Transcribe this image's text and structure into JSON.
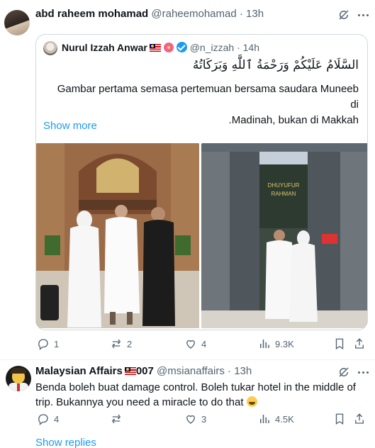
{
  "tweet1": {
    "author_name": "abd raheem mohamad",
    "author_handle": "@raheemohamad",
    "time": "13h",
    "quoted": {
      "author_name": "Nurul Izzah Anwar",
      "author_handle": "@n_izzah",
      "time": "14h",
      "arabic_greeting": "السَّلَامُ عَلَيْكُمْ وَرَحْمَةُ ٱللَّٰهِ وَبَرَكَاتُهُ",
      "body_line1": "Gambar pertama semasa pertemuan bersama saudara Muneeb di",
      "body_line2": ".Madinah, bukan di Makkah",
      "show_more": "Show more",
      "photo1_icon": "photo-icon",
      "photo2_icon": "photo-icon"
    },
    "actions": {
      "replies": "1",
      "reposts": "2",
      "likes": "4",
      "views": "9.3K"
    }
  },
  "tweet2": {
    "author_name": "Malaysian Affairs",
    "author_name_suffix": "007",
    "author_handle": "@msianaffairs",
    "time": "13h",
    "text": "Benda boleh buat damage control. Boleh tukar hotel in the middle of trip. Bukannya you need a miracle to do that",
    "actions": {
      "replies": "4",
      "reposts": "",
      "likes": "3",
      "views": "4.5K"
    },
    "show_replies": "Show replies"
  },
  "colors": {
    "text": "#0f1419",
    "secondary": "#536471",
    "accent": "#1d9bf0",
    "border": "#cfd9de"
  }
}
